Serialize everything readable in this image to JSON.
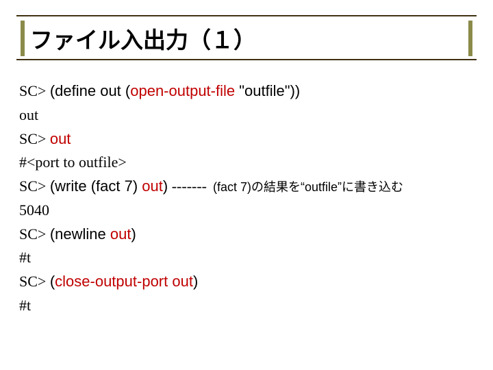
{
  "title": "ファイル入出力（１）",
  "l1": {
    "p": "SC>",
    "a": "(define out (",
    "b": "open-output-file",
    "c": " \"outfile\"))"
  },
  "l2": "out",
  "l3": {
    "p": "SC>",
    "a": "out"
  },
  "l4": "#<port to outfile>",
  "l5": {
    "p": "SC>",
    "a": "(write (fact 7) ",
    "b": "out",
    "c": ")",
    "d": "-------",
    "note": " (fact 7)の結果を“outfile”に書き込む"
  },
  "l6": "5040",
  "l7": {
    "p": "SC>",
    "a": "(newline ",
    "b": "out",
    "c": ")"
  },
  "l8": "#t",
  "l9": {
    "p": "SC>",
    "a": "(",
    "b": "close-output-port out",
    "c": ")"
  },
  "l10": "#t"
}
